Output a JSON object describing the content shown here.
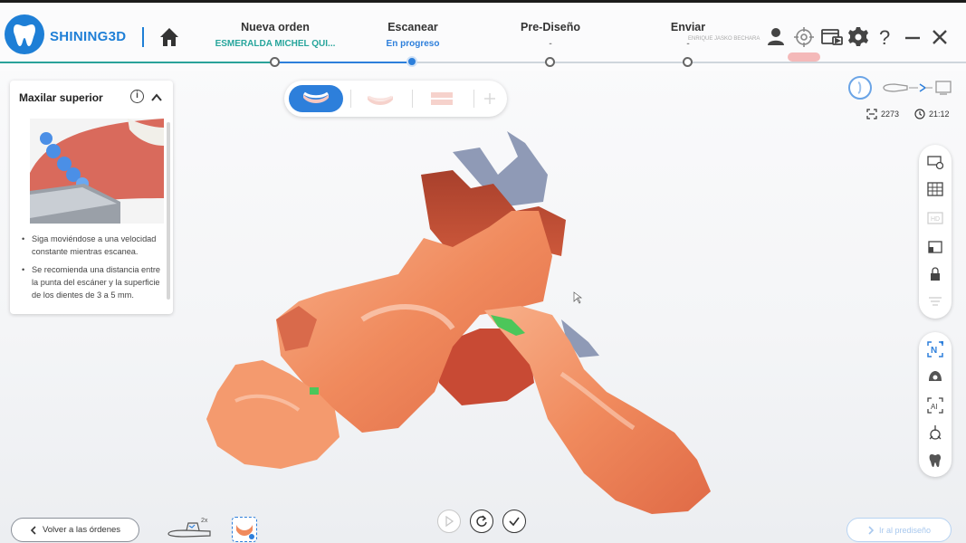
{
  "brand": {
    "name": "SHINING3D",
    "color": "#1e7fd6"
  },
  "steps": [
    {
      "title": "Nueva orden",
      "sub": "ESMERALDA MICHEL QUI...",
      "status": "done"
    },
    {
      "title": "Escanear",
      "sub": "En progreso",
      "status": "active"
    },
    {
      "title": "Pre-Diseño",
      "sub": "-",
      "status": "pending"
    },
    {
      "title": "Enviar",
      "sub": "-",
      "status": "pending"
    }
  ],
  "header": {
    "operator": "ENRIQUE JASKO BECHARA",
    "icons": [
      "user-icon",
      "target-icon",
      "record-icon",
      "gear-icon",
      "help-icon",
      "minimize-icon",
      "close-icon"
    ]
  },
  "guide": {
    "title": "Maxilar superior",
    "tips": [
      "Siga moviéndose a una velocidad constante mientras escanea.",
      "Se recomienda una distancia entre la punta del escáner y la superficie de los dientes de 3 a 5 mm."
    ]
  },
  "stats": {
    "frames": "2273",
    "time": "21:12"
  },
  "footer": {
    "back_label": "Volver a las órdenes",
    "next_label": "Ir al prediseño",
    "tip_multiplier": "2x"
  },
  "colors": {
    "accent": "#2d7fdb",
    "done": "#27a59c",
    "scan": "#f08a5d"
  }
}
